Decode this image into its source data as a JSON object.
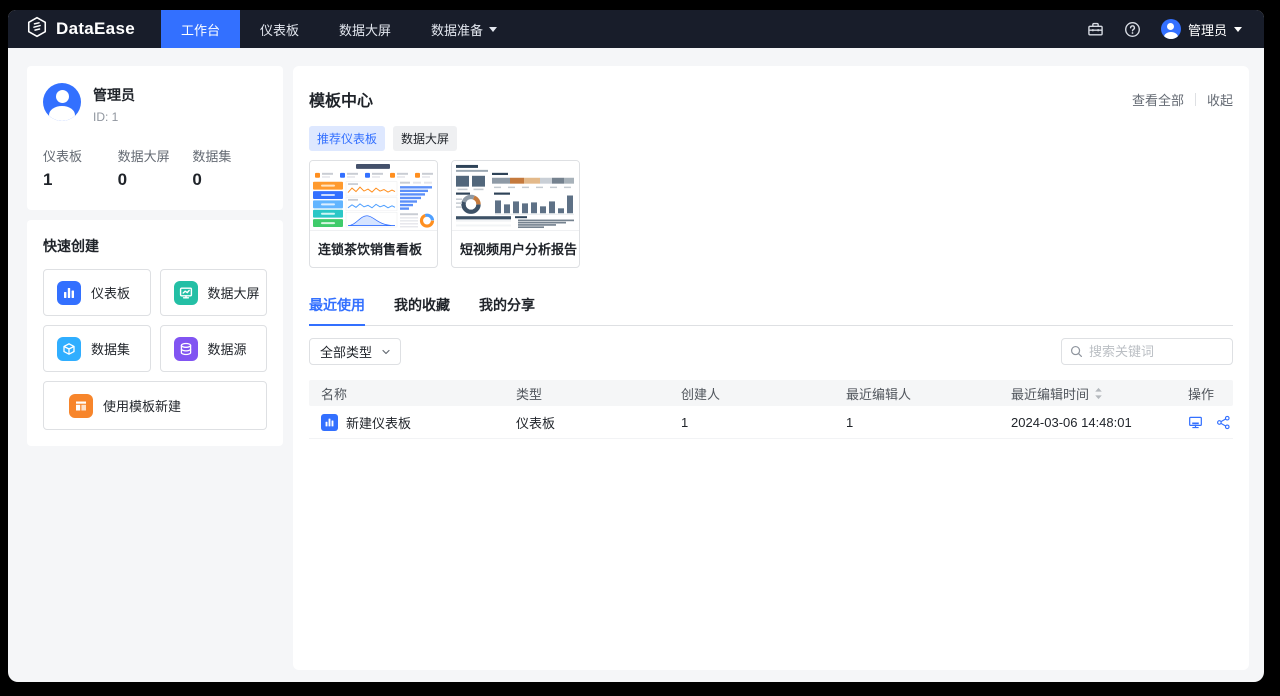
{
  "navbar": {
    "brand": "DataEase",
    "items": [
      {
        "label": "工作台"
      },
      {
        "label": "仪表板"
      },
      {
        "label": "数据大屏"
      },
      {
        "label": "数据准备"
      }
    ],
    "user_name": "管理员"
  },
  "profile": {
    "name": "管理员",
    "id": "ID:  1",
    "stats": [
      {
        "label": "仪表板",
        "value": "1"
      },
      {
        "label": "数据大屏",
        "value": "0"
      },
      {
        "label": "数据集",
        "value": "0"
      }
    ]
  },
  "quick_create": {
    "title": "快速创建",
    "items": [
      {
        "label": "仪表板",
        "color": "#3370FF"
      },
      {
        "label": "数据大屏",
        "color": "#23BFA5"
      },
      {
        "label": "数据集",
        "color": "#30AEFF"
      },
      {
        "label": "数据源",
        "color": "#8154F2"
      },
      {
        "label": "使用模板新建",
        "color": "#F7852B"
      }
    ]
  },
  "template_center": {
    "title": "模板中心",
    "view_all": "查看全部",
    "collapse": "收起",
    "tags": [
      {
        "label": "推荐仪表板"
      },
      {
        "label": "数据大屏"
      }
    ],
    "cards": [
      {
        "title": "连锁茶饮销售看板"
      },
      {
        "title": "短视频用户分析报告"
      }
    ]
  },
  "recent": {
    "tabs": [
      {
        "label": "最近使用"
      },
      {
        "label": "我的收藏"
      },
      {
        "label": "我的分享"
      }
    ],
    "type_filter": "全部类型",
    "search_placeholder": "搜索关键词",
    "table": {
      "columns": [
        "名称",
        "类型",
        "创建人",
        "最近编辑人",
        "最近编辑时间",
        "操作"
      ],
      "rows": [
        {
          "name": "新建仪表板",
          "type": "仪表板",
          "creator": "1",
          "last_editor": "1",
          "last_edited": "2024-03-06 14:48:01"
        }
      ]
    }
  },
  "colors": {
    "accent": "#3370FF",
    "navbar_bg": "#181D2A",
    "page_bg": "#F5F6F8"
  }
}
